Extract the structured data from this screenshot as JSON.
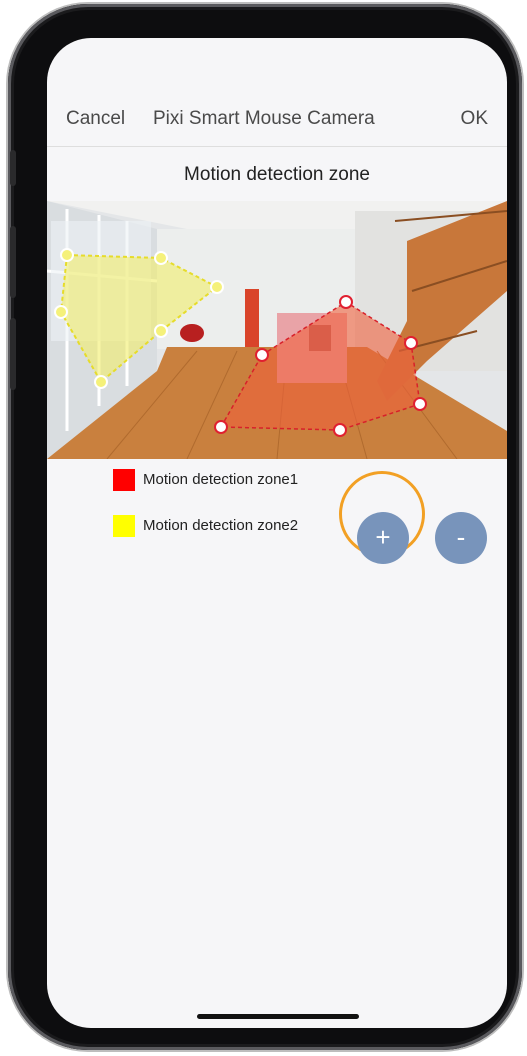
{
  "nav": {
    "cancel_label": "Cancel",
    "title": "Pixi Smart Mouse Camera",
    "ok_label": "OK"
  },
  "section_title": "Motion detection zone",
  "legend": [
    {
      "label": "Motion detection zone1",
      "color": "#ff0000"
    },
    {
      "label": "Motion detection zone2",
      "color": "#ffff00"
    }
  ],
  "buttons": {
    "add_label": "+",
    "remove_label": "-"
  },
  "colors": {
    "accent_ring": "#f2a024",
    "button_bg": "#7894bb",
    "zone1_fill": "#f0603c",
    "zone2_fill": "#f2ee6a"
  },
  "icons": [
    "plus-icon",
    "minus-icon"
  ]
}
